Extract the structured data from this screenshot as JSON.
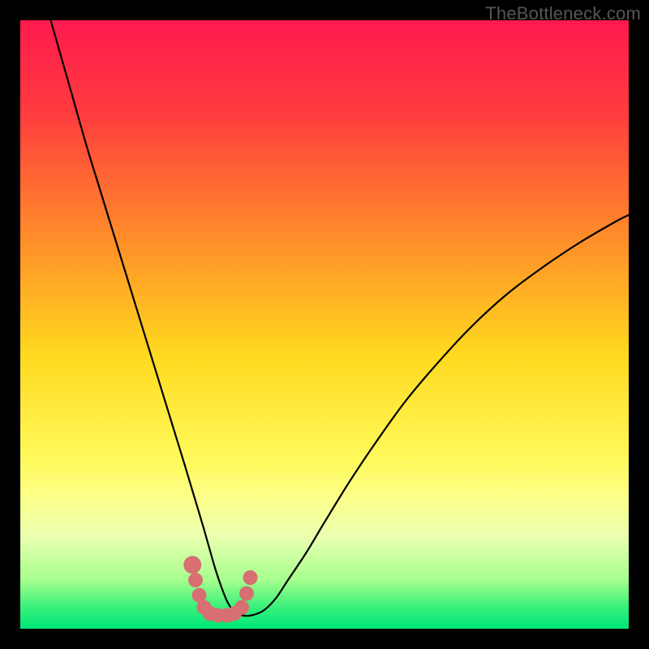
{
  "watermark": "TheBottleneck.com",
  "chart_data": {
    "type": "line",
    "title": "",
    "xlabel": "",
    "ylabel": "",
    "xlim": [
      0,
      100
    ],
    "ylim": [
      0,
      100
    ],
    "grid": false,
    "legend": false,
    "background_gradient": {
      "stops": [
        {
          "offset": 0.0,
          "color": "#ff1a4d"
        },
        {
          "offset": 0.15,
          "color": "#ff3b3f"
        },
        {
          "offset": 0.35,
          "color": "#ff8a2a"
        },
        {
          "offset": 0.55,
          "color": "#ffd91f"
        },
        {
          "offset": 0.72,
          "color": "#fff95a"
        },
        {
          "offset": 0.78,
          "color": "#fdff86"
        },
        {
          "offset": 0.85,
          "color": "#e9ffb0"
        },
        {
          "offset": 0.92,
          "color": "#a6ff8e"
        },
        {
          "offset": 0.965,
          "color": "#36f07a"
        },
        {
          "offset": 1.0,
          "color": "#00e879"
        }
      ]
    },
    "curve": {
      "x": [
        5,
        7,
        9,
        11,
        13,
        15,
        17,
        19,
        21,
        23,
        25,
        27,
        28.5,
        30,
        31,
        32,
        33,
        34,
        35,
        36.5,
        38,
        40,
        42,
        44,
        47,
        50,
        54,
        58,
        63,
        68,
        74,
        80,
        86,
        92,
        98,
        100
      ],
      "y": [
        100,
        93,
        86,
        79,
        72.5,
        66,
        59.5,
        53,
        46.5,
        40,
        33.5,
        27,
        22,
        17,
        13.5,
        10,
        7,
        4.5,
        3,
        2.2,
        2.2,
        3,
        5,
        8,
        12.5,
        17.5,
        24,
        30,
        37,
        43,
        49.5,
        55,
        59.5,
        63.5,
        67,
        68
      ]
    },
    "markers": {
      "color": "#d86f72",
      "points": [
        {
          "x": 28.3,
          "y": 10.5,
          "r": 2.0
        },
        {
          "x": 28.8,
          "y": 8.0,
          "r": 1.6
        },
        {
          "x": 29.4,
          "y": 5.5,
          "r": 1.6
        },
        {
          "x": 30.2,
          "y": 3.5,
          "r": 1.6
        },
        {
          "x": 31.2,
          "y": 2.5,
          "r": 1.6
        },
        {
          "x": 32.5,
          "y": 2.2,
          "r": 1.6
        },
        {
          "x": 34.0,
          "y": 2.2,
          "r": 1.6
        },
        {
          "x": 35.2,
          "y": 2.5,
          "r": 1.6
        },
        {
          "x": 36.4,
          "y": 3.5,
          "r": 1.6
        },
        {
          "x": 37.2,
          "y": 5.8,
          "r": 1.6
        },
        {
          "x": 37.8,
          "y": 8.4,
          "r": 1.6
        }
      ]
    }
  }
}
